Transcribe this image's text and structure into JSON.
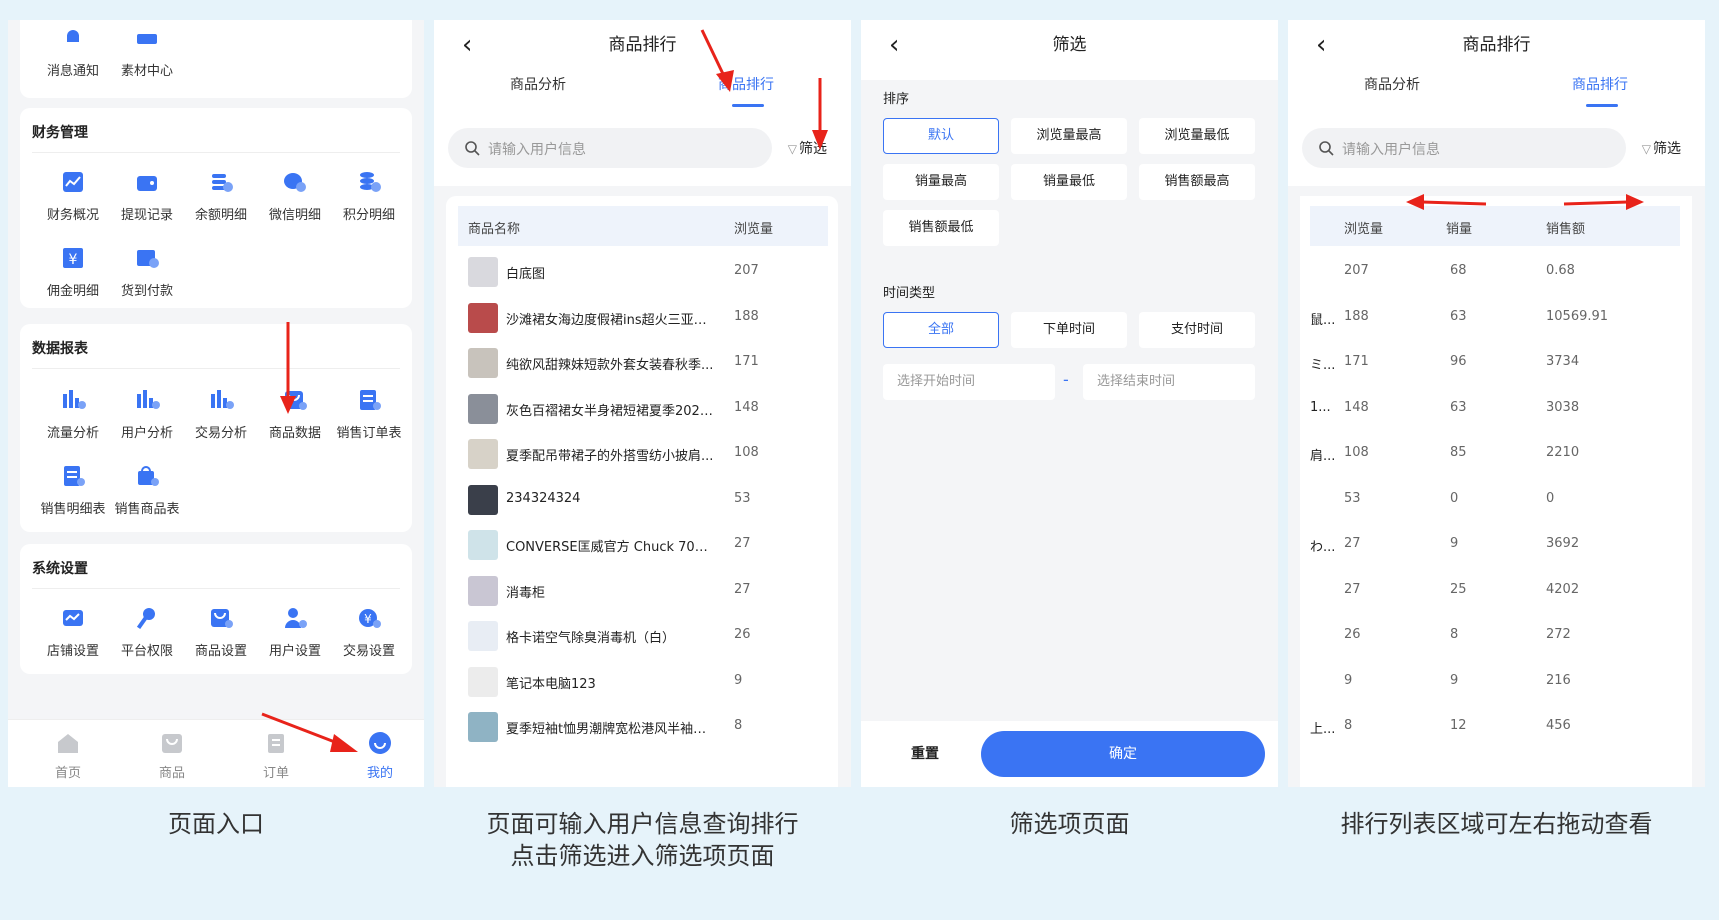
{
  "colors": {
    "accent": "#3a74f3",
    "arrow": "#e8231a",
    "background": "#e6f3fa"
  },
  "panel1": {
    "top_partial": [
      {
        "label": "消息通知",
        "icon": "bell-icon"
      },
      {
        "label": "素材中心",
        "icon": "folder-icon"
      }
    ],
    "sections": [
      {
        "title": "财务管理",
        "items": [
          {
            "label": "财务概况",
            "icon": "chart-icon"
          },
          {
            "label": "提现记录",
            "icon": "wallet-icon"
          },
          {
            "label": "余额明细",
            "icon": "coins-icon"
          },
          {
            "label": "微信明细",
            "icon": "wechat-icon"
          },
          {
            "label": "积分明细",
            "icon": "points-icon"
          },
          {
            "label": "佣金明细",
            "icon": "yen-icon"
          },
          {
            "label": "货到付款",
            "icon": "cod-icon"
          }
        ]
      },
      {
        "title": "数据报表",
        "items": [
          {
            "label": "流量分析",
            "icon": "bar-chart-icon"
          },
          {
            "label": "用户分析",
            "icon": "user-chart-icon"
          },
          {
            "label": "交易分析",
            "icon": "trade-chart-icon"
          },
          {
            "label": "商品数据",
            "icon": "product-data-icon"
          },
          {
            "label": "销售订单表",
            "icon": "order-sheet-icon"
          },
          {
            "label": "销售明细表",
            "icon": "detail-sheet-icon"
          },
          {
            "label": "销售商品表",
            "icon": "bag-sheet-icon"
          }
        ]
      },
      {
        "title": "系统设置",
        "items": [
          {
            "label": "店铺设置",
            "icon": "store-icon"
          },
          {
            "label": "平台权限",
            "icon": "key-icon"
          },
          {
            "label": "商品设置",
            "icon": "product-settings-icon"
          },
          {
            "label": "用户设置",
            "icon": "user-settings-icon"
          },
          {
            "label": "交易设置",
            "icon": "trade-settings-icon"
          }
        ]
      }
    ],
    "tabbar": [
      {
        "label": "首页",
        "icon": "home-icon",
        "active": false
      },
      {
        "label": "商品",
        "icon": "bag-icon",
        "active": false
      },
      {
        "label": "订单",
        "icon": "clipboard-icon",
        "active": false
      },
      {
        "label": "我的",
        "icon": "smile-icon",
        "active": true
      }
    ]
  },
  "ranking": {
    "back": "‹",
    "title": "商品排行",
    "tab_analysis": "商品分析",
    "tab_ranking": "商品排行",
    "search_placeholder": "请输入用户信息",
    "filter_label": "筛选",
    "col_name": "商品名称",
    "col_views": "浏览量",
    "col_sales": "销量",
    "col_revenue": "销售额",
    "rows": [
      {
        "name": "白底图",
        "views": "207",
        "sales": "68",
        "revenue": "0.68",
        "clip": ""
      },
      {
        "name": "沙滩裙女海边度假裙ins超火三亚旅...",
        "views": "188",
        "sales": "63",
        "revenue": "10569.91",
        "clip": "鼠..."
      },
      {
        "name": "纯欲风甜辣妹短款外套女装春秋季...",
        "views": "171",
        "sales": "96",
        "revenue": "3734",
        "clip": "ミ..."
      },
      {
        "name": "灰色百褶裙女半身裙短裙夏季2021...",
        "views": "148",
        "sales": "63",
        "revenue": "3038",
        "clip": "1..."
      },
      {
        "name": "夏季配吊带裙子的外搭雪纺小披肩...",
        "views": "108",
        "sales": "85",
        "revenue": "2210",
        "clip": "肩..."
      },
      {
        "name": "234324324",
        "views": "53",
        "sales": "0",
        "revenue": "0",
        "clip": ""
      },
      {
        "name": "CONVERSE匡威官方 Chuck 70时...",
        "views": "27",
        "sales": "9",
        "revenue": "3692",
        "clip": "わ..."
      },
      {
        "name": "消毒柜",
        "views": "27",
        "sales": "25",
        "revenue": "4202",
        "clip": ""
      },
      {
        "name": "格卡诺空气除臭消毒机（白）",
        "views": "26",
        "sales": "8",
        "revenue": "272",
        "clip": ""
      },
      {
        "name": "笔记本电脑123",
        "views": "9",
        "sales": "9",
        "revenue": "216",
        "clip": ""
      },
      {
        "name": "夏季短袖t恤男潮牌宽松港风半袖上...",
        "views": "8",
        "sales": "12",
        "revenue": "456",
        "clip": "上..."
      }
    ]
  },
  "filter_page": {
    "title": "筛选",
    "sort_label": "排序",
    "sort_options": [
      "默认",
      "浏览量最高",
      "浏览量最低",
      "销量最高",
      "销量最低",
      "销售额最高",
      "销售额最低"
    ],
    "time_type_label": "时间类型",
    "time_options": [
      "全部",
      "下单时间",
      "支付时间"
    ],
    "start_placeholder": "选择开始时间",
    "end_placeholder": "选择结束时间",
    "dash": "-",
    "reset": "重置",
    "confirm": "确定"
  },
  "captions": {
    "c1": "页面入口",
    "c2_line1": "页面可输入用户信息查询排行",
    "c2_line2": "点击筛选进入筛选项页面",
    "c3": "筛选项页面",
    "c4": "排行列表区域可左右拖动查看"
  }
}
